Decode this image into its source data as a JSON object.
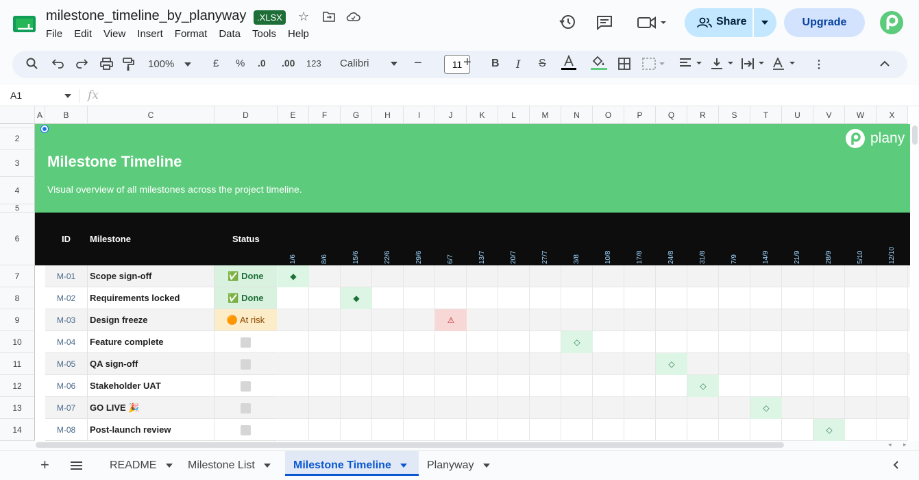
{
  "doc": {
    "title": "milestone_timeline_by_planyway",
    "badge": ".XLSX"
  },
  "menu": [
    "File",
    "Edit",
    "View",
    "Insert",
    "Format",
    "Data",
    "Tools",
    "Help"
  ],
  "share_label": "Share",
  "upgrade_label": "Upgrade",
  "toolbar": {
    "zoom": "100%",
    "currency": "£",
    "percent": "%",
    "dec_less": ".0",
    "dec_more": ".00",
    "format_num": "123",
    "font": "Calibri",
    "font_size": "11"
  },
  "namebox": "A1",
  "fx": "fx",
  "columns": [
    "A",
    "B",
    "C",
    "D",
    "E",
    "F",
    "G",
    "H",
    "I",
    "J",
    "K",
    "L",
    "M",
    "N",
    "O",
    "P",
    "Q",
    "R",
    "S",
    "T",
    "U",
    "V",
    "W",
    "X"
  ],
  "rows": [
    "2",
    "3",
    "4",
    "5",
    "6",
    "7",
    "8",
    "9",
    "10",
    "11",
    "12",
    "13",
    "14"
  ],
  "banner": {
    "title": "Milestone Timeline",
    "subtitle": "Visual overview of all milestones across the project timeline.",
    "logo": "plany"
  },
  "table_header": {
    "id": "ID",
    "milestone": "Milestone",
    "status": "Status"
  },
  "dates": [
    "1/6",
    "8/6",
    "15/6",
    "22/6",
    "29/6",
    "6/7",
    "13/7",
    "20/7",
    "27/7",
    "3/8",
    "10/8",
    "17/8",
    "24/8",
    "31/8",
    "7/9",
    "14/9",
    "21/9",
    "28/9",
    "5/10",
    "12/10"
  ],
  "milestones": [
    {
      "id": "M-01",
      "name": "Scope sign-off",
      "status": "✅ Done",
      "marker": "◆"
    },
    {
      "id": "M-02",
      "name": "Requirements locked",
      "status": "✅ Done",
      "marker": "◆"
    },
    {
      "id": "M-03",
      "name": "Design freeze",
      "status": "🟠 At risk",
      "marker": "⚠"
    },
    {
      "id": "M-04",
      "name": "Feature complete",
      "status": "",
      "marker": "◇"
    },
    {
      "id": "M-05",
      "name": "QA sign-off",
      "status": "",
      "marker": "◇"
    },
    {
      "id": "M-06",
      "name": "Stakeholder UAT",
      "status": "",
      "marker": "◇"
    },
    {
      "id": "M-07",
      "name": "GO LIVE 🎉",
      "status": "",
      "marker": "◇"
    },
    {
      "id": "M-08",
      "name": "Post-launch review",
      "status": "",
      "marker": "◇"
    }
  ],
  "sheets": [
    "README",
    "Milestone List",
    "Milestone Timeline",
    "Planyway"
  ],
  "colors": {
    "banner": "#5ccb7b",
    "done_bg": "#d9f2e0",
    "risk_bg": "#fdecc8",
    "risk_marker_bg": "#f8d7d7",
    "accent": "#0b57d0"
  }
}
